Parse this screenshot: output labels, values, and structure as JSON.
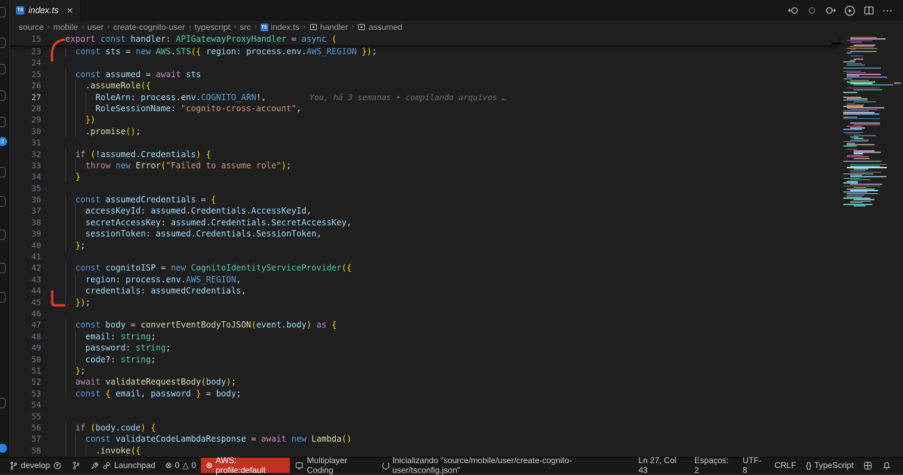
{
  "colors": {
    "accent_badge_blue": "#2584e0",
    "error_badge_red": "#c0301f",
    "ts_icon_blue": "#3178c6",
    "annotation_red": "#e03a2e"
  },
  "activity_bar": {
    "source_control_badge": "2"
  },
  "tab_bar": {
    "tab": {
      "label": "index.ts",
      "close_glyph": "×",
      "file_icon_text": "TS"
    }
  },
  "breadcrumb": {
    "separator": "›",
    "items": [
      {
        "label": "source",
        "icon": "none"
      },
      {
        "label": "mobile",
        "icon": "none"
      },
      {
        "label": "user",
        "icon": "none"
      },
      {
        "label": "create-cognito-user",
        "icon": "none"
      },
      {
        "label": "typescript",
        "icon": "none"
      },
      {
        "label": "src",
        "icon": "none"
      },
      {
        "label": "index.ts",
        "icon": "ts-file-icon"
      },
      {
        "label": "handler",
        "icon": "symbol-variable-icon"
      },
      {
        "label": "assumed",
        "icon": "symbol-variable-icon"
      }
    ]
  },
  "editor": {
    "active_line": "27",
    "blame_line": "27",
    "blame_text": "You, há 3 semanas • compilando arquivos …",
    "sticky_line": {
      "n": "15",
      "i": 0,
      "tokens": [
        [
          "kw",
          "export "
        ],
        [
          "st",
          "const "
        ],
        [
          "vr",
          "handler"
        ],
        [
          "pn",
          ": "
        ],
        [
          "ty",
          "APIGatewayProxyHandler"
        ],
        [
          "pn",
          " = "
        ],
        [
          "st",
          "async "
        ],
        [
          "br",
          "("
        ]
      ]
    },
    "lines": [
      {
        "n": "23",
        "i": 1,
        "tokens": [
          [
            "st",
            "const "
          ],
          [
            "vr",
            "sts"
          ],
          [
            "pn",
            " = "
          ],
          [
            "st",
            "new "
          ],
          [
            "ty",
            "AWS"
          ],
          [
            "pn",
            "."
          ],
          [
            "ty",
            "STS"
          ],
          [
            "br",
            "({"
          ],
          [
            "pln",
            " "
          ],
          [
            "vr",
            "region"
          ],
          [
            "pn",
            ": "
          ],
          [
            "vr",
            "process"
          ],
          [
            "pn",
            "."
          ],
          [
            "vr",
            "env"
          ],
          [
            "pn",
            "."
          ],
          [
            "st",
            "AWS_REGION"
          ],
          [
            "pln",
            " "
          ],
          [
            "br",
            "})"
          ],
          [
            "pn",
            ";"
          ]
        ]
      },
      {
        "n": "24",
        "i": 0,
        "tokens": []
      },
      {
        "n": "25",
        "i": 1,
        "tokens": [
          [
            "st",
            "const "
          ],
          [
            "vr",
            "assumed"
          ],
          [
            "pn",
            " = "
          ],
          [
            "kw",
            "await "
          ],
          [
            "vr",
            "sts"
          ]
        ]
      },
      {
        "n": "26",
        "i": 2,
        "tokens": [
          [
            "pn",
            "."
          ],
          [
            "fn",
            "assumeRole"
          ],
          [
            "br",
            "({"
          ]
        ]
      },
      {
        "n": "27",
        "i": 3,
        "tokens": [
          [
            "vr",
            "RoleArn"
          ],
          [
            "pn",
            ": "
          ],
          [
            "vr",
            "process"
          ],
          [
            "pn",
            "."
          ],
          [
            "vr",
            "env"
          ],
          [
            "pn",
            "."
          ],
          [
            "st",
            "COGNITO_ARN"
          ],
          [
            "pn",
            "!,"
          ]
        ]
      },
      {
        "n": "28",
        "i": 3,
        "tokens": [
          [
            "vr",
            "RoleSessionName"
          ],
          [
            "pn",
            ": "
          ],
          [
            "str",
            "\"cognito-cross-account\""
          ],
          [
            "pn",
            ","
          ]
        ]
      },
      {
        "n": "29",
        "i": 2,
        "tokens": [
          [
            "br",
            "})"
          ]
        ]
      },
      {
        "n": "30",
        "i": 2,
        "tokens": [
          [
            "pn",
            "."
          ],
          [
            "fn",
            "promise"
          ],
          [
            "br",
            "()"
          ],
          [
            "pn",
            ";"
          ]
        ]
      },
      {
        "n": "31",
        "i": 0,
        "tokens": []
      },
      {
        "n": "32",
        "i": 1,
        "tokens": [
          [
            "kw",
            "if "
          ],
          [
            "br",
            "("
          ],
          [
            "pn",
            "!"
          ],
          [
            "vr",
            "assumed"
          ],
          [
            "pn",
            "."
          ],
          [
            "vr",
            "Credentials"
          ],
          [
            "br",
            ")"
          ],
          [
            "pln",
            " "
          ],
          [
            "br",
            "{"
          ]
        ]
      },
      {
        "n": "33",
        "i": 2,
        "tokens": [
          [
            "kw",
            "throw "
          ],
          [
            "st",
            "new "
          ],
          [
            "fn",
            "Error"
          ],
          [
            "br",
            "("
          ],
          [
            "str",
            "\"Failed to assume role\""
          ],
          [
            "br",
            ")"
          ],
          [
            "pn",
            ";"
          ]
        ]
      },
      {
        "n": "34",
        "i": 1,
        "tokens": [
          [
            "br",
            "}"
          ]
        ]
      },
      {
        "n": "35",
        "i": 0,
        "tokens": []
      },
      {
        "n": "36",
        "i": 1,
        "tokens": [
          [
            "st",
            "const "
          ],
          [
            "vr",
            "assumedCredentials"
          ],
          [
            "pn",
            " = "
          ],
          [
            "br",
            "{"
          ]
        ]
      },
      {
        "n": "37",
        "i": 2,
        "tokens": [
          [
            "vr",
            "accessKeyId"
          ],
          [
            "pn",
            ": "
          ],
          [
            "vr",
            "assumed"
          ],
          [
            "pn",
            "."
          ],
          [
            "vr",
            "Credentials"
          ],
          [
            "pn",
            "."
          ],
          [
            "vr",
            "AccessKeyId"
          ],
          [
            "pn",
            ","
          ]
        ]
      },
      {
        "n": "38",
        "i": 2,
        "tokens": [
          [
            "vr",
            "secretAccessKey"
          ],
          [
            "pn",
            ": "
          ],
          [
            "vr",
            "assumed"
          ],
          [
            "pn",
            "."
          ],
          [
            "vr",
            "Credentials"
          ],
          [
            "pn",
            "."
          ],
          [
            "vr",
            "SecretAccessKey"
          ],
          [
            "pn",
            ","
          ]
        ]
      },
      {
        "n": "39",
        "i": 2,
        "tokens": [
          [
            "vr",
            "sessionToken"
          ],
          [
            "pn",
            ": "
          ],
          [
            "vr",
            "assumed"
          ],
          [
            "pn",
            "."
          ],
          [
            "vr",
            "Credentials"
          ],
          [
            "pn",
            "."
          ],
          [
            "vr",
            "SessionToken"
          ],
          [
            "pn",
            ","
          ]
        ]
      },
      {
        "n": "40",
        "i": 1,
        "tokens": [
          [
            "br",
            "}"
          ],
          [
            "pn",
            ";"
          ]
        ]
      },
      {
        "n": "41",
        "i": 0,
        "tokens": []
      },
      {
        "n": "42",
        "i": 1,
        "tokens": [
          [
            "st",
            "const "
          ],
          [
            "vr",
            "cognitoISP"
          ],
          [
            "pn",
            " = "
          ],
          [
            "st",
            "new "
          ],
          [
            "ty",
            "CognitoIdentityServiceProvider"
          ],
          [
            "br",
            "({"
          ]
        ]
      },
      {
        "n": "43",
        "i": 2,
        "tokens": [
          [
            "vr",
            "region"
          ],
          [
            "pn",
            ": "
          ],
          [
            "vr",
            "process"
          ],
          [
            "pn",
            "."
          ],
          [
            "vr",
            "env"
          ],
          [
            "pn",
            "."
          ],
          [
            "st",
            "AWS_REGION"
          ],
          [
            "pn",
            ","
          ]
        ]
      },
      {
        "n": "44",
        "i": 2,
        "tokens": [
          [
            "vr",
            "credentials"
          ],
          [
            "pn",
            ": "
          ],
          [
            "vr",
            "assumedCredentials"
          ],
          [
            "pn",
            ","
          ]
        ]
      },
      {
        "n": "45",
        "i": 1,
        "tokens": [
          [
            "br",
            "})"
          ],
          [
            "pn",
            ";"
          ]
        ]
      },
      {
        "n": "46",
        "i": 0,
        "tokens": []
      },
      {
        "n": "47",
        "i": 1,
        "tokens": [
          [
            "st",
            "const "
          ],
          [
            "vr",
            "body"
          ],
          [
            "pn",
            " = "
          ],
          [
            "fn",
            "convertEventBodyToJSON"
          ],
          [
            "br",
            "("
          ],
          [
            "vr",
            "event"
          ],
          [
            "pn",
            "."
          ],
          [
            "vr",
            "body"
          ],
          [
            "br",
            ")"
          ],
          [
            "kw",
            " as "
          ],
          [
            "br",
            "{"
          ]
        ]
      },
      {
        "n": "48",
        "i": 2,
        "tokens": [
          [
            "vr",
            "email"
          ],
          [
            "pn",
            ": "
          ],
          [
            "ty",
            "string"
          ],
          [
            "pn",
            ";"
          ]
        ]
      },
      {
        "n": "49",
        "i": 2,
        "tokens": [
          [
            "vr",
            "password"
          ],
          [
            "pn",
            ": "
          ],
          [
            "ty",
            "string"
          ],
          [
            "pn",
            ";"
          ]
        ]
      },
      {
        "n": "50",
        "i": 2,
        "tokens": [
          [
            "vr",
            "code"
          ],
          [
            "pn",
            "?: "
          ],
          [
            "ty",
            "string"
          ],
          [
            "pn",
            ";"
          ]
        ]
      },
      {
        "n": "51",
        "i": 1,
        "tokens": [
          [
            "br",
            "}"
          ],
          [
            "pn",
            ";"
          ]
        ]
      },
      {
        "n": "52",
        "i": 1,
        "tokens": [
          [
            "kw",
            "await "
          ],
          [
            "fn",
            "validateRequestBody"
          ],
          [
            "br",
            "("
          ],
          [
            "vr",
            "body"
          ],
          [
            "br",
            ")"
          ],
          [
            "pn",
            ";"
          ]
        ]
      },
      {
        "n": "53",
        "i": 1,
        "tokens": [
          [
            "st",
            "const "
          ],
          [
            "br",
            "{"
          ],
          [
            "vr",
            " email"
          ],
          [
            "pn",
            ","
          ],
          [
            "vr",
            " password"
          ],
          [
            "pln",
            " "
          ],
          [
            "br",
            "}"
          ],
          [
            "pn",
            " = "
          ],
          [
            "vr",
            "body"
          ],
          [
            "pn",
            ";"
          ]
        ]
      },
      {
        "n": "54",
        "i": 0,
        "tokens": []
      },
      {
        "n": "55",
        "i": 0,
        "tokens": []
      },
      {
        "n": "56",
        "i": 1,
        "tokens": [
          [
            "kw",
            "if "
          ],
          [
            "br",
            "("
          ],
          [
            "vr",
            "body"
          ],
          [
            "pn",
            "."
          ],
          [
            "vr",
            "code"
          ],
          [
            "br",
            ")"
          ],
          [
            "pln",
            " "
          ],
          [
            "br",
            "{"
          ]
        ]
      },
      {
        "n": "57",
        "i": 2,
        "tokens": [
          [
            "st",
            "const "
          ],
          [
            "vr",
            "validateCodeLambdaResponse"
          ],
          [
            "pn",
            " = "
          ],
          [
            "kw",
            "await "
          ],
          [
            "st",
            "new "
          ],
          [
            "fn",
            "Lambda"
          ],
          [
            "br",
            "()"
          ]
        ]
      },
      {
        "n": "58",
        "i": 3,
        "tokens": [
          [
            "pn",
            "."
          ],
          [
            "fn",
            "invoke"
          ],
          [
            "br",
            "({"
          ]
        ]
      }
    ]
  },
  "status_bar": {
    "left": [
      {
        "name": "branch",
        "label": "develop"
      },
      {
        "name": "compare-branch",
        "label": ""
      },
      {
        "name": "launchpad",
        "label": "Launchpad"
      },
      {
        "name": "problems",
        "errors": "0",
        "warnings": "0"
      },
      {
        "name": "aws-profile",
        "label": "AWS: profile:default",
        "error": true
      },
      {
        "name": "multiplayer",
        "label": "Multiplayer Coding"
      },
      {
        "name": "init-task",
        "label": "Inicializando \"source/mobile/user/create-cognito-user/tsconfig.json\"",
        "spinner": true
      }
    ],
    "right": [
      {
        "name": "cursor-position",
        "label": "Ln 27, Col 43"
      },
      {
        "name": "indentation",
        "label": "Espaços: 2"
      },
      {
        "name": "encoding",
        "label": "UTF-8"
      },
      {
        "name": "eol",
        "label": "CRLF"
      },
      {
        "name": "language-mode",
        "label": "TypeScript",
        "icon": "braces"
      },
      {
        "name": "feedback",
        "label": "",
        "icon": "grid"
      },
      {
        "name": "notifications",
        "label": "",
        "icon": "bell"
      }
    ]
  }
}
